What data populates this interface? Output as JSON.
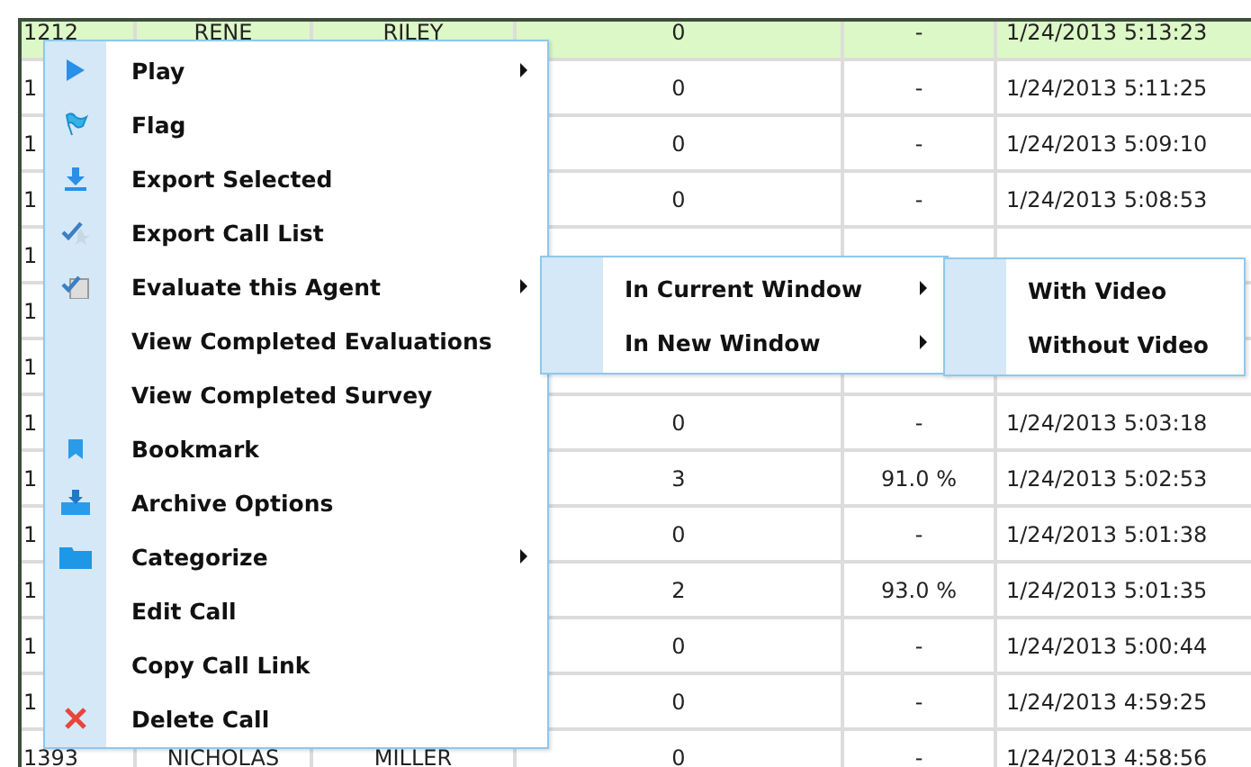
{
  "table": {
    "rows": [
      {
        "selected": true,
        "cells": [
          "1212",
          "RENE",
          "RILEY",
          "0",
          "-",
          "1/24/2013 5:13:23"
        ]
      },
      {
        "selected": false,
        "cells": [
          "1",
          "",
          "",
          "0",
          "-",
          "1/24/2013 5:11:25"
        ]
      },
      {
        "selected": false,
        "cells": [
          "1",
          "",
          "",
          "0",
          "-",
          "1/24/2013 5:09:10"
        ]
      },
      {
        "selected": false,
        "cells": [
          "1",
          "",
          "",
          "0",
          "-",
          "1/24/2013 5:08:53"
        ]
      },
      {
        "selected": false,
        "cells": [
          "1",
          "",
          "",
          "",
          "",
          ""
        ]
      },
      {
        "selected": false,
        "cells": [
          "1",
          "",
          "",
          "",
          "",
          ""
        ]
      },
      {
        "selected": false,
        "cells": [
          "1",
          "",
          "",
          "",
          "",
          ""
        ]
      },
      {
        "selected": false,
        "cells": [
          "1",
          "",
          "",
          "0",
          "-",
          "1/24/2013 5:03:18"
        ]
      },
      {
        "selected": false,
        "cells": [
          "1",
          "",
          "",
          "3",
          "91.0 %",
          "1/24/2013 5:02:53"
        ]
      },
      {
        "selected": false,
        "cells": [
          "1",
          "",
          "",
          "0",
          "-",
          "1/24/2013 5:01:38"
        ]
      },
      {
        "selected": false,
        "cells": [
          "1",
          "",
          "",
          "2",
          "93.0 %",
          "1/24/2013 5:01:35"
        ]
      },
      {
        "selected": false,
        "cells": [
          "1",
          "",
          "",
          "0",
          "-",
          "1/24/2013 5:00:44"
        ]
      },
      {
        "selected": false,
        "cells": [
          "1",
          "",
          "",
          "0",
          "-",
          "1/24/2013 4:59:25"
        ]
      },
      {
        "selected": false,
        "cells": [
          "1393",
          "NICHOLAS",
          "MILLER",
          "0",
          "-",
          "1/24/2013 4:58:56"
        ]
      }
    ]
  },
  "context_menu": {
    "items": [
      {
        "label": "Play",
        "has_submenu": true
      },
      {
        "label": "Flag",
        "has_submenu": false
      },
      {
        "label": "Export Selected",
        "has_submenu": false
      },
      {
        "label": "Export Call List",
        "has_submenu": false
      },
      {
        "label": "Evaluate this Agent",
        "has_submenu": true
      },
      {
        "label": "View Completed Evaluations",
        "has_submenu": false
      },
      {
        "label": "View Completed Survey",
        "has_submenu": false
      },
      {
        "label": "Bookmark",
        "has_submenu": false
      },
      {
        "label": "Archive Options",
        "has_submenu": false
      },
      {
        "label": "Categorize",
        "has_submenu": true
      },
      {
        "label": "Edit Call",
        "has_submenu": false
      },
      {
        "label": "Copy Call Link",
        "has_submenu": false
      },
      {
        "label": "Delete Call",
        "has_submenu": false
      }
    ]
  },
  "submenu": {
    "items": [
      {
        "label": "In Current Window",
        "has_submenu": true
      },
      {
        "label": "In New Window",
        "has_submenu": true
      }
    ]
  },
  "submenu_2": {
    "items": [
      {
        "label": "With Video",
        "has_submenu": false
      },
      {
        "label": "Without Video",
        "has_submenu": false
      }
    ]
  }
}
